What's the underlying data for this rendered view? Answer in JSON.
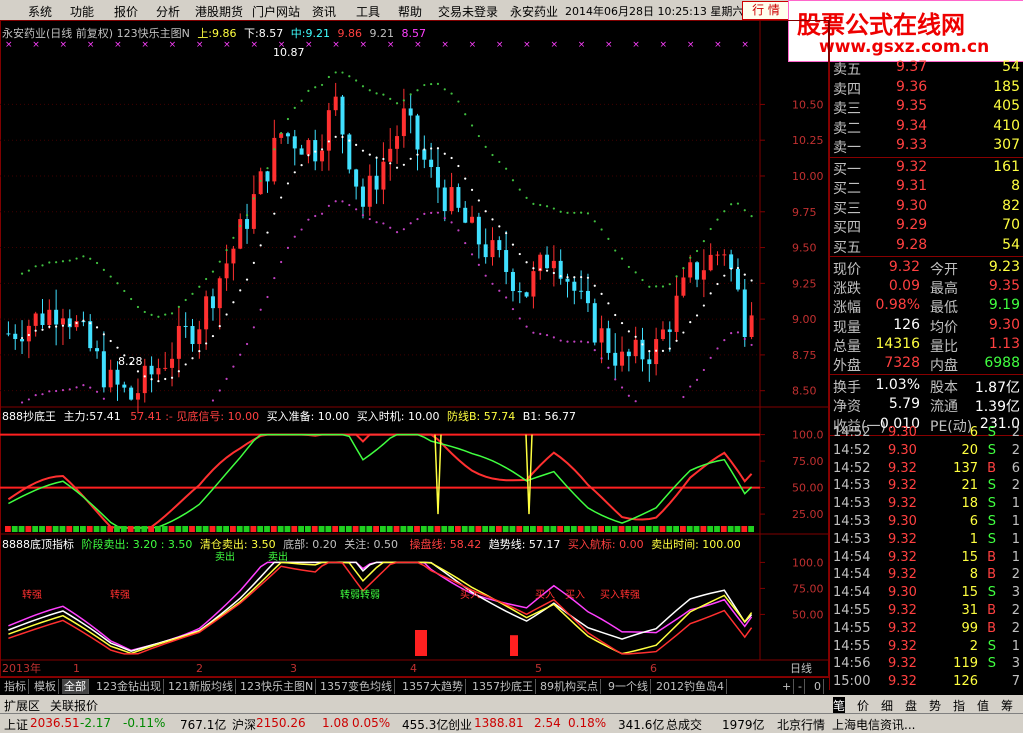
{
  "menu": {
    "items": [
      "系统",
      "功能",
      "报价",
      "分析",
      "港股期货",
      "门户网站",
      "资讯",
      "工具",
      "帮助",
      "交易未登录"
    ],
    "stock_name": "永安药业",
    "datetime": "2014年06月28日  10:25:13  星期六",
    "trade_label": "行 情"
  },
  "watermark": {
    "line1": "股票公式在线网",
    "line2": "www.gsxz.com.cn"
  },
  "main": {
    "title": "永安药业(日线 前复权) 123快乐主图N",
    "up_label": "上:",
    "up_val": "9.86",
    "down_label": "下:",
    "down_val": "8.57",
    "mid_label": "中:",
    "mid_val": "9.21",
    "v4": "9.86",
    "v5": "9.21",
    "v6": "8.57",
    "hi_mark": "10.87",
    "lo_mark": "8.28",
    "price_ticks": [
      "10.50",
      "10.25",
      "10.00",
      "9.75",
      "9.50",
      "9.25",
      "9.00",
      "8.75",
      "8.50"
    ]
  },
  "ind1": {
    "title": "888抄底王",
    "main_label": "主力:",
    "main_val": "57.41",
    "main_val2": "57.41",
    "signal": ":- 见底信号: 10.00",
    "buy_prep": "买入准备: 10.00",
    "buy_time": "买入时机: 10.00",
    "defense": "防线B: 57.74",
    "b1": "B1: 56.77",
    "ticks": [
      "100.0",
      "75.00",
      "50.00",
      "25.00"
    ]
  },
  "ind2": {
    "title": "8888底顶指标",
    "stage_sell": "阶段卖出: 3.20 : 3.50",
    "clear_sell": "清仓卖出: 3.50",
    "bottom": "底部: 0.20",
    "focus": "关注: 0.50",
    "op_line": "操盘线: 58.42",
    "trend": "趋势线: 57.17",
    "buy_sail": "买入航标: 0.00",
    "sell_time": "卖出时间: 100.00",
    "ticks": [
      "100.0",
      "75.00",
      "50.00"
    ],
    "notes": [
      "卖出",
      "卖出",
      "转强",
      "转强",
      "转弱",
      "转弱",
      "转强",
      "买入",
      "买入",
      "买入",
      "买入"
    ]
  },
  "xaxis": {
    "labels": [
      "2013年",
      "1",
      "2",
      "3",
      "4",
      "5",
      "6"
    ],
    "period": "日线"
  },
  "tabs": [
    "指标",
    "模板",
    "全部",
    "123金钻出现",
    "121新版均线",
    "123快乐主图N",
    "1357变色均线",
    "1357大趋势",
    "1357抄底王",
    "89机构买点",
    "9一个线",
    "2012钓鱼岛4"
  ],
  "tab_ctrl": [
    "+",
    "-",
    "0"
  ],
  "bottom_tabs": [
    "扩展区",
    "关联报价"
  ],
  "orderbook": {
    "asks": [
      {
        "label": "卖五",
        "price": "9.37",
        "vol": "54"
      },
      {
        "label": "卖四",
        "price": "9.36",
        "vol": "185"
      },
      {
        "label": "卖三",
        "price": "9.35",
        "vol": "405"
      },
      {
        "label": "卖二",
        "price": "9.34",
        "vol": "410"
      },
      {
        "label": "卖一",
        "price": "9.33",
        "vol": "307"
      }
    ],
    "bids": [
      {
        "label": "买一",
        "price": "9.32",
        "vol": "161"
      },
      {
        "label": "买二",
        "price": "9.31",
        "vol": "8"
      },
      {
        "label": "买三",
        "price": "9.30",
        "vol": "82"
      },
      {
        "label": "买四",
        "price": "9.29",
        "vol": "70"
      },
      {
        "label": "买五",
        "price": "9.28",
        "vol": "54"
      }
    ]
  },
  "quote": {
    "rows": [
      {
        "l1": "现价",
        "v1": "9.32",
        "c1": "#ff4040",
        "l2": "今开",
        "v2": "9.23",
        "c2": "#ffff40"
      },
      {
        "l1": "涨跌",
        "v1": "0.09",
        "c1": "#ff4040",
        "l2": "最高",
        "v2": "9.35",
        "c2": "#ff4040"
      },
      {
        "l1": "涨幅",
        "v1": "0.98%",
        "c1": "#ff4040",
        "l2": "最低",
        "v2": "9.19",
        "c2": "#40ff40"
      },
      {
        "l1": "现量",
        "v1": "126",
        "c1": "#ffffff",
        "l2": "均价",
        "v2": "9.30",
        "c2": "#ff4040"
      },
      {
        "l1": "总量",
        "v1": "14316",
        "c1": "#ffff40",
        "l2": "量比",
        "v2": "1.13",
        "c2": "#ff4040"
      },
      {
        "l1": "外盘",
        "v1": "7328",
        "c1": "#ff4040",
        "l2": "内盘",
        "v2": "6988",
        "c2": "#40ff40"
      }
    ],
    "rows2": [
      {
        "l1": "换手",
        "v1": "1.03%",
        "l2": "股本",
        "v2": "1.87亿"
      },
      {
        "l1": "净资",
        "v1": "5.79",
        "l2": "流通",
        "v2": "1.39亿"
      },
      {
        "l1": "收益(一)",
        "v1": "0.010",
        "l2": "PE(动)",
        "v2": "231.0"
      }
    ]
  },
  "ticks": [
    {
      "t": "14:52",
      "p": "9.30",
      "v": "6",
      "d": "S",
      "n": "2"
    },
    {
      "t": "14:52",
      "p": "9.30",
      "v": "20",
      "d": "S",
      "n": "2"
    },
    {
      "t": "14:52",
      "p": "9.32",
      "v": "137",
      "d": "B",
      "n": "6"
    },
    {
      "t": "14:53",
      "p": "9.32",
      "v": "21",
      "d": "S",
      "n": "2"
    },
    {
      "t": "14:53",
      "p": "9.32",
      "v": "18",
      "d": "S",
      "n": "1"
    },
    {
      "t": "14:53",
      "p": "9.30",
      "v": "6",
      "d": "S",
      "n": "1"
    },
    {
      "t": "14:53",
      "p": "9.32",
      "v": "1",
      "d": "S",
      "n": "1"
    },
    {
      "t": "14:54",
      "p": "9.32",
      "v": "15",
      "d": "B",
      "n": "1"
    },
    {
      "t": "14:54",
      "p": "9.32",
      "v": "8",
      "d": "B",
      "n": "2"
    },
    {
      "t": "14:54",
      "p": "9.30",
      "v": "15",
      "d": "S",
      "n": "3"
    },
    {
      "t": "14:55",
      "p": "9.32",
      "v": "31",
      "d": "B",
      "n": "2"
    },
    {
      "t": "14:55",
      "p": "9.32",
      "v": "99",
      "d": "B",
      "n": "2"
    },
    {
      "t": "14:55",
      "p": "9.32",
      "v": "2",
      "d": "S",
      "n": "1"
    },
    {
      "t": "14:56",
      "p": "9.32",
      "v": "119",
      "d": "S",
      "n": "3"
    },
    {
      "t": "15:00",
      "p": "9.32",
      "v": "126",
      "d": "",
      "n": "7"
    }
  ],
  "right_tabs": [
    "笔",
    "价",
    "细",
    "盘",
    "势",
    "指",
    "值",
    "筹"
  ],
  "status": {
    "sh_label": "上证",
    "sh_val": "2036.51",
    "sh_chg": "-2.17",
    "sh_pct": "-0.11%",
    "sh_amt": "767.1亿",
    "sz_label": "沪深",
    "sz_val": "2150.26",
    "sz_chg": "1.08",
    "sz_pct": "0.05%",
    "sz_amt": "455.3亿",
    "cy_label": "创业",
    "cy_val": "1388.81",
    "cy_chg": "2.54",
    "cy_pct": "0.18%",
    "cy_amt": "341.6亿",
    "total_label": "总成交",
    "total_val": "1979亿",
    "region": "北京行情",
    "telecom": "上海电信资讯..."
  },
  "colors": {
    "up": "#ff3030",
    "down": "#40e0ff",
    "grid": "#800000"
  }
}
